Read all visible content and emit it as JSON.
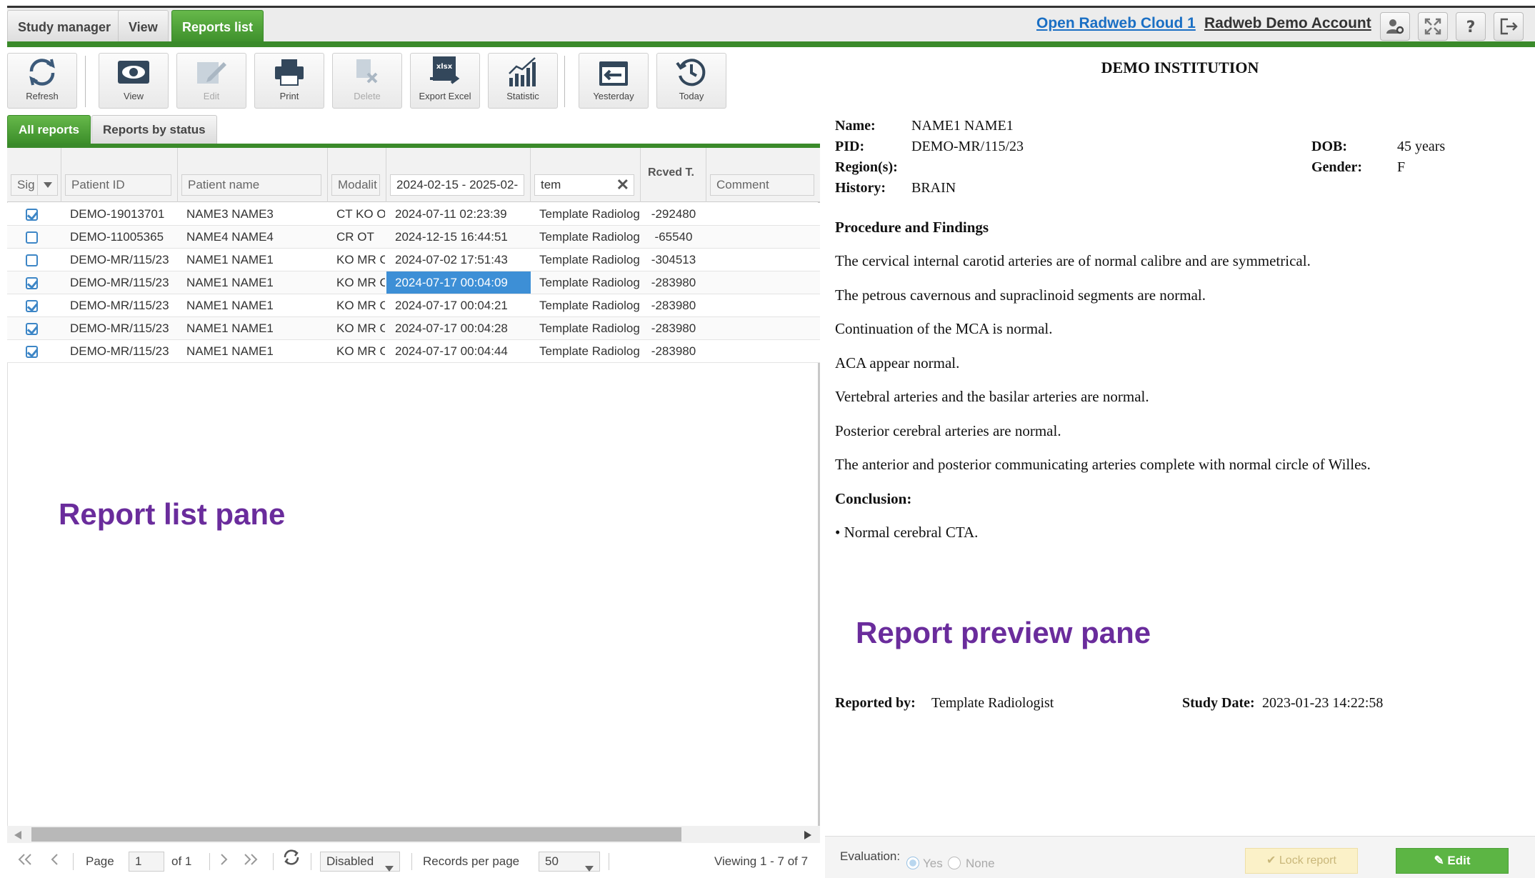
{
  "topbar": {
    "tabs": [
      {
        "label": "Study manager"
      },
      {
        "label": "View"
      },
      {
        "label": "Reports list"
      }
    ],
    "cloud_link": "Open Radweb Cloud 1",
    "account_link": "Radweb Demo Account",
    "icons": [
      "settings-user-icon",
      "fullscreen-icon",
      "help-icon",
      "logout-icon"
    ]
  },
  "toolbar": {
    "refresh": "Refresh",
    "view": "View",
    "edit": "Edit",
    "print": "Print",
    "delete": "Delete",
    "export_excel": "Export Excel",
    "statistic": "Statistic",
    "yesterday": "Yesterday",
    "today": "Today",
    "xlsx_tag": "xlsx"
  },
  "report_tabs": [
    {
      "label": "All reports"
    },
    {
      "label": "Reports by status"
    }
  ],
  "grid": {
    "columns": {
      "sig": "Sig",
      "patient_id": "Patient ID",
      "patient_name": "Patient name",
      "modality": "Modalit",
      "date": "",
      "template": "",
      "rcved": "Rcved T.",
      "comment": "Comment"
    },
    "filters": {
      "date": "2024-02-15 - 2025-02-",
      "template": "tem"
    },
    "rows": [
      {
        "signed": true,
        "patient_id": "DEMO-19013701",
        "patient_name": "NAME3 NAME3",
        "modality": "CT KO O",
        "date": "2024-07-11 02:23:39",
        "template": "Template Radiologis",
        "rcved": "-292480"
      },
      {
        "signed": false,
        "patient_id": "DEMO-11005365",
        "patient_name": "NAME4 NAME4",
        "modality": "CR OT",
        "date": "2024-12-15 16:44:51",
        "template": "Template Radiologis",
        "rcved": "-65540"
      },
      {
        "signed": false,
        "patient_id": "DEMO-MR/115/23",
        "patient_name": "NAME1 NAME1",
        "modality": "KO MR C",
        "date": "2024-07-02 17:51:43",
        "template": "Template Radiologis",
        "rcved": "-304513"
      },
      {
        "signed": true,
        "patient_id": "DEMO-MR/115/23",
        "patient_name": "NAME1 NAME1",
        "modality": "KO MR C",
        "date": "2024-07-17 00:04:09",
        "template": "Template Radiologis",
        "rcved": "-283980"
      },
      {
        "signed": true,
        "patient_id": "DEMO-MR/115/23",
        "patient_name": "NAME1 NAME1",
        "modality": "KO MR C",
        "date": "2024-07-17 00:04:21",
        "template": "Template Radiologis",
        "rcved": "-283980"
      },
      {
        "signed": true,
        "patient_id": "DEMO-MR/115/23",
        "patient_name": "NAME1 NAME1",
        "modality": "KO MR C",
        "date": "2024-07-17 00:04:28",
        "template": "Template Radiologis",
        "rcved": "-283980"
      },
      {
        "signed": true,
        "patient_id": "DEMO-MR/115/23",
        "patient_name": "NAME1 NAME1",
        "modality": "KO MR C",
        "date": "2024-07-17 00:04:44",
        "template": "Template Radiologis",
        "rcved": "-283980"
      }
    ]
  },
  "labels": {
    "list_pane": "Report list pane",
    "preview_pane": "Report preview pane"
  },
  "pager": {
    "page_label": "Page",
    "page_value": "1",
    "of_label": "of 1",
    "disabled": "Disabled",
    "records_label": "Records per page",
    "records_value": "50",
    "viewing": "Viewing 1 - 7 of 7"
  },
  "preview": {
    "institution": "DEMO INSTITUTION",
    "name_label": "Name:",
    "name_value": "NAME1 NAME1",
    "pid_label": "PID:",
    "pid_value": "DEMO-MR/115/23",
    "region_label": "Region(s):",
    "history_label": "History:",
    "history_value": "BRAIN",
    "dob_label": "DOB:",
    "dob_value": "45 years",
    "gender_label": "Gender:",
    "gender_value": "F",
    "findings_heading": "Procedure and Findings",
    "paragraphs": [
      "The cervical internal carotid arteries are of normal calibre and are symmetrical.",
      "The petrous cavernous and supraclinoid segments are normal.",
      "Continuation of the MCA is normal.",
      "ACA appear normal.",
      "Vertebral arteries and the basilar arteries are normal.",
      "Posterior cerebral arteries are normal.",
      "The anterior and posterior communicating arteries complete with normal circle of Willes."
    ],
    "conclusion_heading": "Conclusion:",
    "conclusion": "• Normal cerebral CTA.",
    "reported_by_label": "Reported by:",
    "reported_by_value": "Template Radiologist",
    "study_date_label": "Study Date:",
    "study_date_value": "2023-01-23 14:22:58"
  },
  "bottom": {
    "evaluation_label": "Evaluation:",
    "yes": "Yes",
    "none": "None",
    "lock": "Lock report",
    "edit": "Edit"
  }
}
